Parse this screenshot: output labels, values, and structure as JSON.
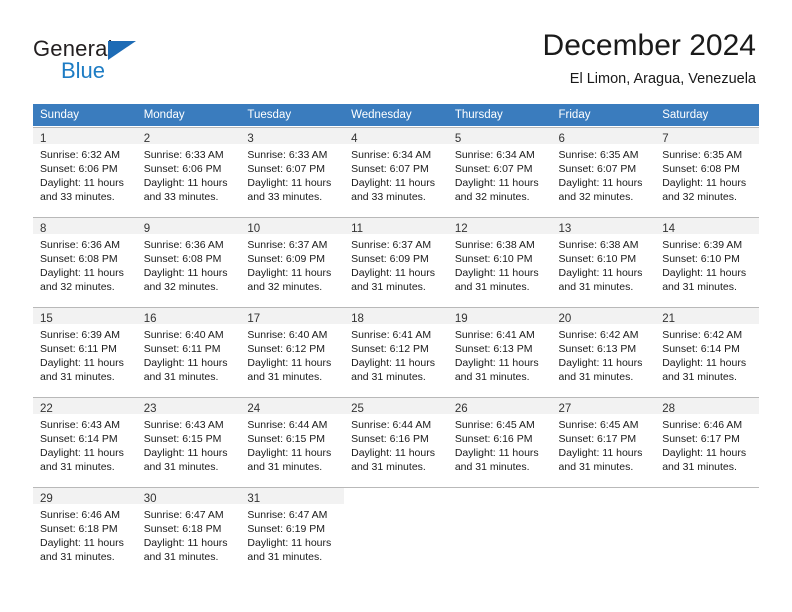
{
  "brand": {
    "name_part1": "General",
    "name_part2": "Blue",
    "triangle_color": "#1d6bb5",
    "blue_color": "#1d7cc4"
  },
  "header": {
    "month_title": "December 2024",
    "location": "El Limon, Aragua, Venezuela"
  },
  "calendar": {
    "header_bg": "#3a7cbe",
    "daynum_band_bg": "#f2f2f2",
    "weekday_headers": [
      "Sunday",
      "Monday",
      "Tuesday",
      "Wednesday",
      "Thursday",
      "Friday",
      "Saturday"
    ],
    "weeks": [
      [
        {
          "day": "1",
          "sunrise": "Sunrise: 6:32 AM",
          "sunset": "Sunset: 6:06 PM",
          "daylight_line1": "Daylight: 11 hours",
          "daylight_line2": "and 33 minutes."
        },
        {
          "day": "2",
          "sunrise": "Sunrise: 6:33 AM",
          "sunset": "Sunset: 6:06 PM",
          "daylight_line1": "Daylight: 11 hours",
          "daylight_line2": "and 33 minutes."
        },
        {
          "day": "3",
          "sunrise": "Sunrise: 6:33 AM",
          "sunset": "Sunset: 6:07 PM",
          "daylight_line1": "Daylight: 11 hours",
          "daylight_line2": "and 33 minutes."
        },
        {
          "day": "4",
          "sunrise": "Sunrise: 6:34 AM",
          "sunset": "Sunset: 6:07 PM",
          "daylight_line1": "Daylight: 11 hours",
          "daylight_line2": "and 33 minutes."
        },
        {
          "day": "5",
          "sunrise": "Sunrise: 6:34 AM",
          "sunset": "Sunset: 6:07 PM",
          "daylight_line1": "Daylight: 11 hours",
          "daylight_line2": "and 32 minutes."
        },
        {
          "day": "6",
          "sunrise": "Sunrise: 6:35 AM",
          "sunset": "Sunset: 6:07 PM",
          "daylight_line1": "Daylight: 11 hours",
          "daylight_line2": "and 32 minutes."
        },
        {
          "day": "7",
          "sunrise": "Sunrise: 6:35 AM",
          "sunset": "Sunset: 6:08 PM",
          "daylight_line1": "Daylight: 11 hours",
          "daylight_line2": "and 32 minutes."
        }
      ],
      [
        {
          "day": "8",
          "sunrise": "Sunrise: 6:36 AM",
          "sunset": "Sunset: 6:08 PM",
          "daylight_line1": "Daylight: 11 hours",
          "daylight_line2": "and 32 minutes."
        },
        {
          "day": "9",
          "sunrise": "Sunrise: 6:36 AM",
          "sunset": "Sunset: 6:08 PM",
          "daylight_line1": "Daylight: 11 hours",
          "daylight_line2": "and 32 minutes."
        },
        {
          "day": "10",
          "sunrise": "Sunrise: 6:37 AM",
          "sunset": "Sunset: 6:09 PM",
          "daylight_line1": "Daylight: 11 hours",
          "daylight_line2": "and 32 minutes."
        },
        {
          "day": "11",
          "sunrise": "Sunrise: 6:37 AM",
          "sunset": "Sunset: 6:09 PM",
          "daylight_line1": "Daylight: 11 hours",
          "daylight_line2": "and 31 minutes."
        },
        {
          "day": "12",
          "sunrise": "Sunrise: 6:38 AM",
          "sunset": "Sunset: 6:10 PM",
          "daylight_line1": "Daylight: 11 hours",
          "daylight_line2": "and 31 minutes."
        },
        {
          "day": "13",
          "sunrise": "Sunrise: 6:38 AM",
          "sunset": "Sunset: 6:10 PM",
          "daylight_line1": "Daylight: 11 hours",
          "daylight_line2": "and 31 minutes."
        },
        {
          "day": "14",
          "sunrise": "Sunrise: 6:39 AM",
          "sunset": "Sunset: 6:10 PM",
          "daylight_line1": "Daylight: 11 hours",
          "daylight_line2": "and 31 minutes."
        }
      ],
      [
        {
          "day": "15",
          "sunrise": "Sunrise: 6:39 AM",
          "sunset": "Sunset: 6:11 PM",
          "daylight_line1": "Daylight: 11 hours",
          "daylight_line2": "and 31 minutes."
        },
        {
          "day": "16",
          "sunrise": "Sunrise: 6:40 AM",
          "sunset": "Sunset: 6:11 PM",
          "daylight_line1": "Daylight: 11 hours",
          "daylight_line2": "and 31 minutes."
        },
        {
          "day": "17",
          "sunrise": "Sunrise: 6:40 AM",
          "sunset": "Sunset: 6:12 PM",
          "daylight_line1": "Daylight: 11 hours",
          "daylight_line2": "and 31 minutes."
        },
        {
          "day": "18",
          "sunrise": "Sunrise: 6:41 AM",
          "sunset": "Sunset: 6:12 PM",
          "daylight_line1": "Daylight: 11 hours",
          "daylight_line2": "and 31 minutes."
        },
        {
          "day": "19",
          "sunrise": "Sunrise: 6:41 AM",
          "sunset": "Sunset: 6:13 PM",
          "daylight_line1": "Daylight: 11 hours",
          "daylight_line2": "and 31 minutes."
        },
        {
          "day": "20",
          "sunrise": "Sunrise: 6:42 AM",
          "sunset": "Sunset: 6:13 PM",
          "daylight_line1": "Daylight: 11 hours",
          "daylight_line2": "and 31 minutes."
        },
        {
          "day": "21",
          "sunrise": "Sunrise: 6:42 AM",
          "sunset": "Sunset: 6:14 PM",
          "daylight_line1": "Daylight: 11 hours",
          "daylight_line2": "and 31 minutes."
        }
      ],
      [
        {
          "day": "22",
          "sunrise": "Sunrise: 6:43 AM",
          "sunset": "Sunset: 6:14 PM",
          "daylight_line1": "Daylight: 11 hours",
          "daylight_line2": "and 31 minutes."
        },
        {
          "day": "23",
          "sunrise": "Sunrise: 6:43 AM",
          "sunset": "Sunset: 6:15 PM",
          "daylight_line1": "Daylight: 11 hours",
          "daylight_line2": "and 31 minutes."
        },
        {
          "day": "24",
          "sunrise": "Sunrise: 6:44 AM",
          "sunset": "Sunset: 6:15 PM",
          "daylight_line1": "Daylight: 11 hours",
          "daylight_line2": "and 31 minutes."
        },
        {
          "day": "25",
          "sunrise": "Sunrise: 6:44 AM",
          "sunset": "Sunset: 6:16 PM",
          "daylight_line1": "Daylight: 11 hours",
          "daylight_line2": "and 31 minutes."
        },
        {
          "day": "26",
          "sunrise": "Sunrise: 6:45 AM",
          "sunset": "Sunset: 6:16 PM",
          "daylight_line1": "Daylight: 11 hours",
          "daylight_line2": "and 31 minutes."
        },
        {
          "day": "27",
          "sunrise": "Sunrise: 6:45 AM",
          "sunset": "Sunset: 6:17 PM",
          "daylight_line1": "Daylight: 11 hours",
          "daylight_line2": "and 31 minutes."
        },
        {
          "day": "28",
          "sunrise": "Sunrise: 6:46 AM",
          "sunset": "Sunset: 6:17 PM",
          "daylight_line1": "Daylight: 11 hours",
          "daylight_line2": "and 31 minutes."
        }
      ],
      [
        {
          "day": "29",
          "sunrise": "Sunrise: 6:46 AM",
          "sunset": "Sunset: 6:18 PM",
          "daylight_line1": "Daylight: 11 hours",
          "daylight_line2": "and 31 minutes."
        },
        {
          "day": "30",
          "sunrise": "Sunrise: 6:47 AM",
          "sunset": "Sunset: 6:18 PM",
          "daylight_line1": "Daylight: 11 hours",
          "daylight_line2": "and 31 minutes."
        },
        {
          "day": "31",
          "sunrise": "Sunrise: 6:47 AM",
          "sunset": "Sunset: 6:19 PM",
          "daylight_line1": "Daylight: 11 hours",
          "daylight_line2": "and 31 minutes."
        },
        {
          "day": "",
          "sunrise": "",
          "sunset": "",
          "daylight_line1": "",
          "daylight_line2": ""
        },
        {
          "day": "",
          "sunrise": "",
          "sunset": "",
          "daylight_line1": "",
          "daylight_line2": ""
        },
        {
          "day": "",
          "sunrise": "",
          "sunset": "",
          "daylight_line1": "",
          "daylight_line2": ""
        },
        {
          "day": "",
          "sunrise": "",
          "sunset": "",
          "daylight_line1": "",
          "daylight_line2": ""
        }
      ]
    ]
  }
}
